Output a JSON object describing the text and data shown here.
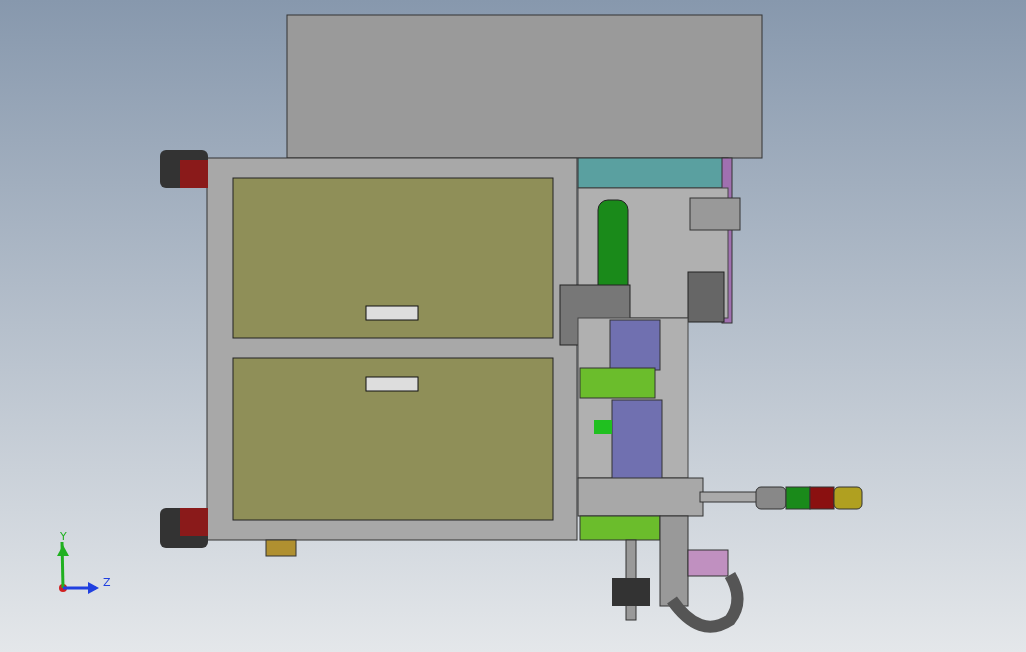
{
  "viewport": {
    "triad": {
      "axes": [
        {
          "label": "Y",
          "kind": "vertical"
        },
        {
          "label": "Z",
          "kind": "horizontal"
        }
      ]
    }
  }
}
